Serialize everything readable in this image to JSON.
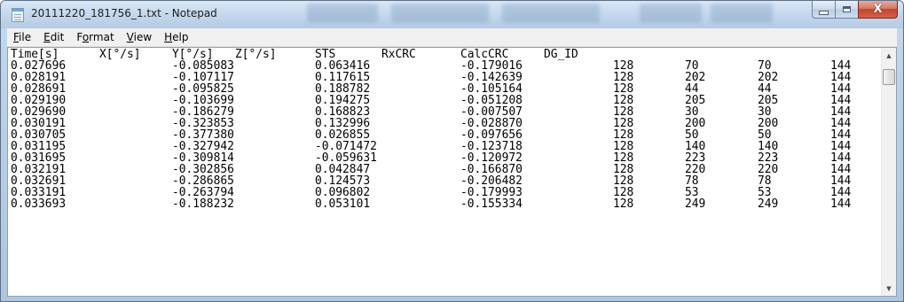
{
  "window": {
    "title": "20111220_181756_1.txt - Notepad",
    "controls": {
      "minimize": "minimize",
      "maximize": "maximize",
      "close": "close"
    }
  },
  "menu": [
    {
      "label": "File",
      "u": "F",
      "rest": "ile"
    },
    {
      "label": "Edit",
      "u": "E",
      "rest": "dit"
    },
    {
      "label": "Format",
      "pre": "F",
      "u": "o",
      "rest": "rmat"
    },
    {
      "label": "View",
      "u": "V",
      "rest": "iew"
    },
    {
      "label": "Help",
      "u": "H",
      "rest": "elp"
    }
  ],
  "content": {
    "header": [
      "Time[s]",
      "X[°/s]",
      "Y[°/s]",
      "Z[°/s]",
      "STS",
      "RxCRC",
      "CalcCRC",
      "DG_ID"
    ],
    "rows": [
      [
        "0.027696",
        "-0.085083",
        "0.063416",
        "-0.179016",
        "128",
        "70",
        "70",
        "144"
      ],
      [
        "0.028191",
        "-0.107117",
        "0.117615",
        "-0.142639",
        "128",
        "202",
        "202",
        "144"
      ],
      [
        "0.028691",
        "-0.095825",
        "0.188782",
        "-0.105164",
        "128",
        "44",
        "44",
        "144"
      ],
      [
        "0.029190",
        "-0.103699",
        "0.194275",
        "-0.051208",
        "128",
        "205",
        "205",
        "144"
      ],
      [
        "0.029690",
        "-0.186279",
        "0.168823",
        "-0.007507",
        "128",
        "30",
        "30",
        "144"
      ],
      [
        "0.030191",
        "-0.323853",
        "0.132996",
        "-0.028870",
        "128",
        "200",
        "200",
        "144"
      ],
      [
        "0.030705",
        "-0.377380",
        "0.026855",
        "-0.097656",
        "128",
        "50",
        "50",
        "144"
      ],
      [
        "0.031195",
        "-0.327942",
        "-0.071472",
        "-0.123718",
        "128",
        "140",
        "140",
        "144"
      ],
      [
        "0.031695",
        "-0.309814",
        "-0.059631",
        "-0.120972",
        "128",
        "223",
        "223",
        "144"
      ],
      [
        "0.032191",
        "-0.302856",
        "0.042847",
        "-0.166870",
        "128",
        "220",
        "220",
        "144"
      ],
      [
        "0.032691",
        "-0.286865",
        "0.124573",
        "-0.206482",
        "128",
        "78",
        "78",
        "144"
      ],
      [
        "0.033191",
        "-0.263794",
        "0.096802",
        "-0.179993",
        "128",
        "53",
        "53",
        "144"
      ],
      [
        "0.033693",
        "-0.188232",
        "0.053101",
        "-0.155334",
        "128",
        "249",
        "249",
        "144"
      ]
    ]
  },
  "scrollbar": {
    "up": "▲",
    "down": "▼"
  }
}
